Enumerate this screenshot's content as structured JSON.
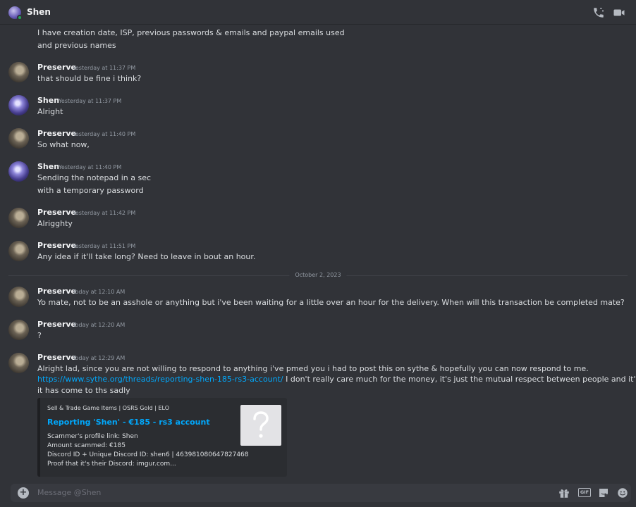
{
  "header": {
    "title": "Shen",
    "status_color": "#23a55a"
  },
  "messages": [
    {
      "lines": [
        "I have creation date, ISP, previous passwords & emails and paypal emails used",
        "and previous names"
      ]
    },
    {
      "author": "Preserve",
      "timestamp": "Yesterday at 11:37 PM",
      "lines": [
        "that should be fine i think?"
      ]
    },
    {
      "author": "Shen",
      "timestamp": "Yesterday at 11:37 PM",
      "lines": [
        "Alright"
      ]
    },
    {
      "author": "Preserve",
      "timestamp": "Yesterday at 11:40 PM",
      "lines": [
        "So what now,"
      ]
    },
    {
      "author": "Shen",
      "timestamp": "Yesterday at 11:40 PM",
      "lines": [
        "Sending the notepad in a sec",
        "with a temporary password"
      ]
    },
    {
      "author": "Preserve",
      "timestamp": "Yesterday at 11:42 PM",
      "lines": [
        "Alrigghty"
      ]
    },
    {
      "author": "Preserve",
      "timestamp": "Yesterday at 11:51 PM",
      "lines": [
        "Any idea if it'll take long? Need to leave in bout an hour."
      ]
    },
    {
      "author": "Preserve",
      "timestamp": "Today at 12:10 AM",
      "lines": [
        "Yo mate, not to be an asshole or anything but i've been waiting for a little over an hour for the delivery. When will this transaction be completed mate?"
      ]
    },
    {
      "author": "Preserve",
      "timestamp": "Today at 12:20 AM",
      "lines": [
        "?"
      ]
    },
    {
      "author": "Preserve",
      "timestamp": "Today at 12:29 AM",
      "lines": [
        "Alright lad, since you are not willing to respond to anything i've pmed you i had to post this on sythe & hopefully you can now respond to me.",
        "",
        "it has come to ths sadly"
      ],
      "link": "https://www.sythe.org/threads/reporting-shen-185-rs3-account/",
      "after_link": " I don't really care much for the money, it's just the mutual respect between people and it's sad how"
    }
  ],
  "date_divider": "October 2, 2023",
  "embed": {
    "provider": "Sell & Trade Game Items | OSRS Gold | ELO",
    "title": "Reporting 'Shen' - €185 - rs3 account",
    "description": [
      "Scammer's profile link: Shen",
      "Amount scammed: €185",
      "Discord ID + Unique Discord ID: shen6 | 463981080647827468",
      "Proof that it's their Discord: imgur.com..."
    ],
    "thumbnail_icon": "question-mark-icon"
  },
  "composer": {
    "placeholder": "Message @Shen",
    "gif_label": "GIF"
  },
  "icons": [
    "phone-icon",
    "video-icon",
    "plus-icon",
    "gift-icon",
    "gif-icon",
    "sticker-icon",
    "emoji-icon"
  ],
  "colors": {
    "background": "#313338",
    "link": "#00a8fc",
    "muted": "#949ba4"
  }
}
